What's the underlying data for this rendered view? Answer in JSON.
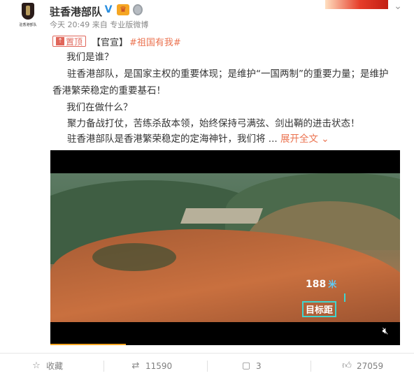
{
  "post": {
    "author": {
      "name": "驻香港部队",
      "verified_icon": "verified-v-icon",
      "avatar_caption": "驻香港部队"
    },
    "meta": {
      "time": "今天 20:49",
      "source": "来自 专业版微博"
    },
    "badge": {
      "label": "置顶",
      "icon": "pin-top-icon"
    },
    "bracket_label": "【官宣】",
    "hashtag": "#祖国有我#",
    "lines": [
      "我们是谁？",
      "驻香港部队，是国家主权的重要体现；是维护“一国两制”的重要力量；是维护",
      "香港繁荣稳定的重要基石！",
      "我们在做什么？",
      "聚力备战打仗，苦练杀敌本领，始终保持弓满弦、剑出鞘的进击状态！",
      "驻香港部队是香港繁荣稳定的定海神针，我们将 ..."
    ],
    "expand_label": "展开全文",
    "video": {
      "overlay_distance": "188",
      "overlay_unit": "米",
      "overlay_target": "目标距",
      "progress": 0.216
    },
    "actions": {
      "favorite_label": "收藏",
      "repost_count": "11590",
      "comment_count": "3",
      "like_count": "27059"
    }
  },
  "colors": {
    "accent": "#eb7350",
    "verified": "#2a8fe0",
    "progress": "#f5a623",
    "text": "#333333",
    "muted": "#888888"
  }
}
